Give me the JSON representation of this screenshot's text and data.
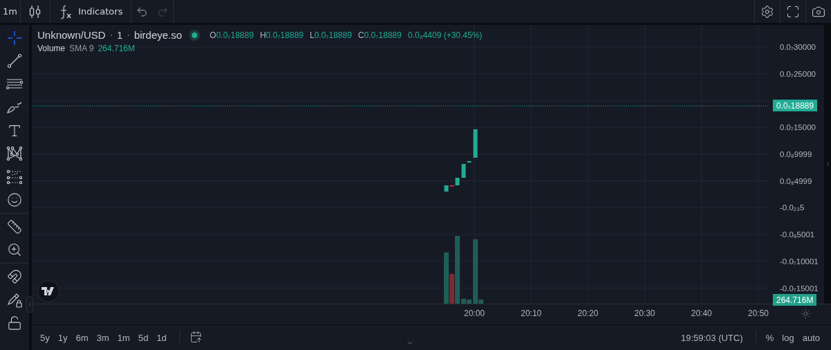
{
  "top_bar": {
    "interval": "1m",
    "indicators_label": "Indicators",
    "undo_disabled": false,
    "redo_disabled": true
  },
  "drawing_tools": [
    {
      "kind": "crosshair",
      "selected": true
    },
    {
      "kind": "trend-line",
      "selected": false
    },
    {
      "kind": "lines",
      "selected": false
    },
    {
      "kind": "brush",
      "selected": false
    },
    {
      "kind": "text",
      "selected": false
    },
    {
      "kind": "pattern",
      "selected": false
    },
    {
      "kind": "forecast",
      "selected": false
    },
    {
      "kind": "emoji",
      "selected": false
    },
    {
      "kind": "ruler",
      "selected": false
    },
    {
      "kind": "zoom",
      "selected": false
    },
    {
      "kind": "magnet",
      "selected": false
    },
    {
      "kind": "lock-drawing",
      "selected": false
    },
    {
      "kind": "lock",
      "selected": false
    }
  ],
  "legend": {
    "symbol": "Unknown/USD",
    "separator_1": "·",
    "interval": "1",
    "separator_2": "·",
    "source": "birdeye.so",
    "ohlc": [
      {
        "label": "O",
        "value": "0.0₇18889"
      },
      {
        "label": "H",
        "value": "0.0₇18889"
      },
      {
        "label": "L",
        "value": "0.0₇18889"
      },
      {
        "label": "C",
        "value": "0.0₇18889"
      }
    ],
    "change": "0.0₈4409 (+30.45%)"
  },
  "volume": {
    "name": "Volume",
    "ma": "SMA 9",
    "value": "264.716M"
  },
  "price_axis": {
    "labels_above": [
      "0.0₇30000",
      "0.0₇25000"
    ],
    "last_price": "0.0₇18889",
    "labels_below": [
      "0.0₇15000",
      "0.0₈9999",
      "0.0₈4999",
      "-0.0₂₃5",
      "-0.0₈5001",
      "-0.0₇10001",
      "-0.0₇15001"
    ],
    "volume_value": "264.716M"
  },
  "time_axis": [
    "20:00",
    "20:10",
    "20:20",
    "20:30",
    "20:40",
    "20:50"
  ],
  "ranges": [
    "5y",
    "1y",
    "6m",
    "3m",
    "1m",
    "5d",
    "1d"
  ],
  "clock": "19:59:03 (UTC)",
  "scale_options": [
    "%",
    "log",
    "auto"
  ]
}
